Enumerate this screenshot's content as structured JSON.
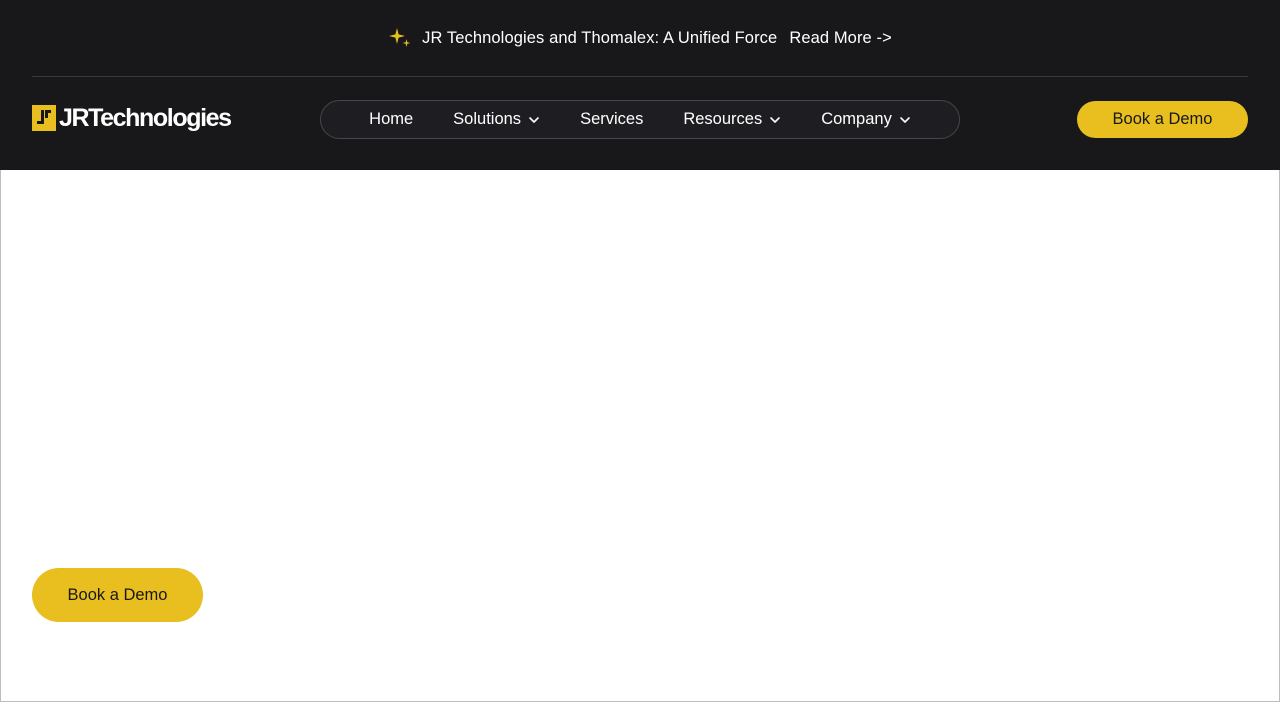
{
  "announcement": {
    "icon": "sparkle-icon",
    "text": "JR Technologies and Thomalex: A Unified Force",
    "link_label": "Read More ->"
  },
  "brand": {
    "logo_text": "JRTechnologies",
    "accent_color": "#e8bf1e",
    "header_bg": "#18171a"
  },
  "nav": {
    "items": [
      {
        "label": "Home",
        "has_dropdown": false
      },
      {
        "label": "Solutions",
        "has_dropdown": true
      },
      {
        "label": "Services",
        "has_dropdown": false
      },
      {
        "label": "Resources",
        "has_dropdown": true
      },
      {
        "label": "Company",
        "has_dropdown": true
      }
    ]
  },
  "header": {
    "cta_label": "Book a Demo"
  },
  "hero": {
    "cta_label": "Book a Demo"
  }
}
